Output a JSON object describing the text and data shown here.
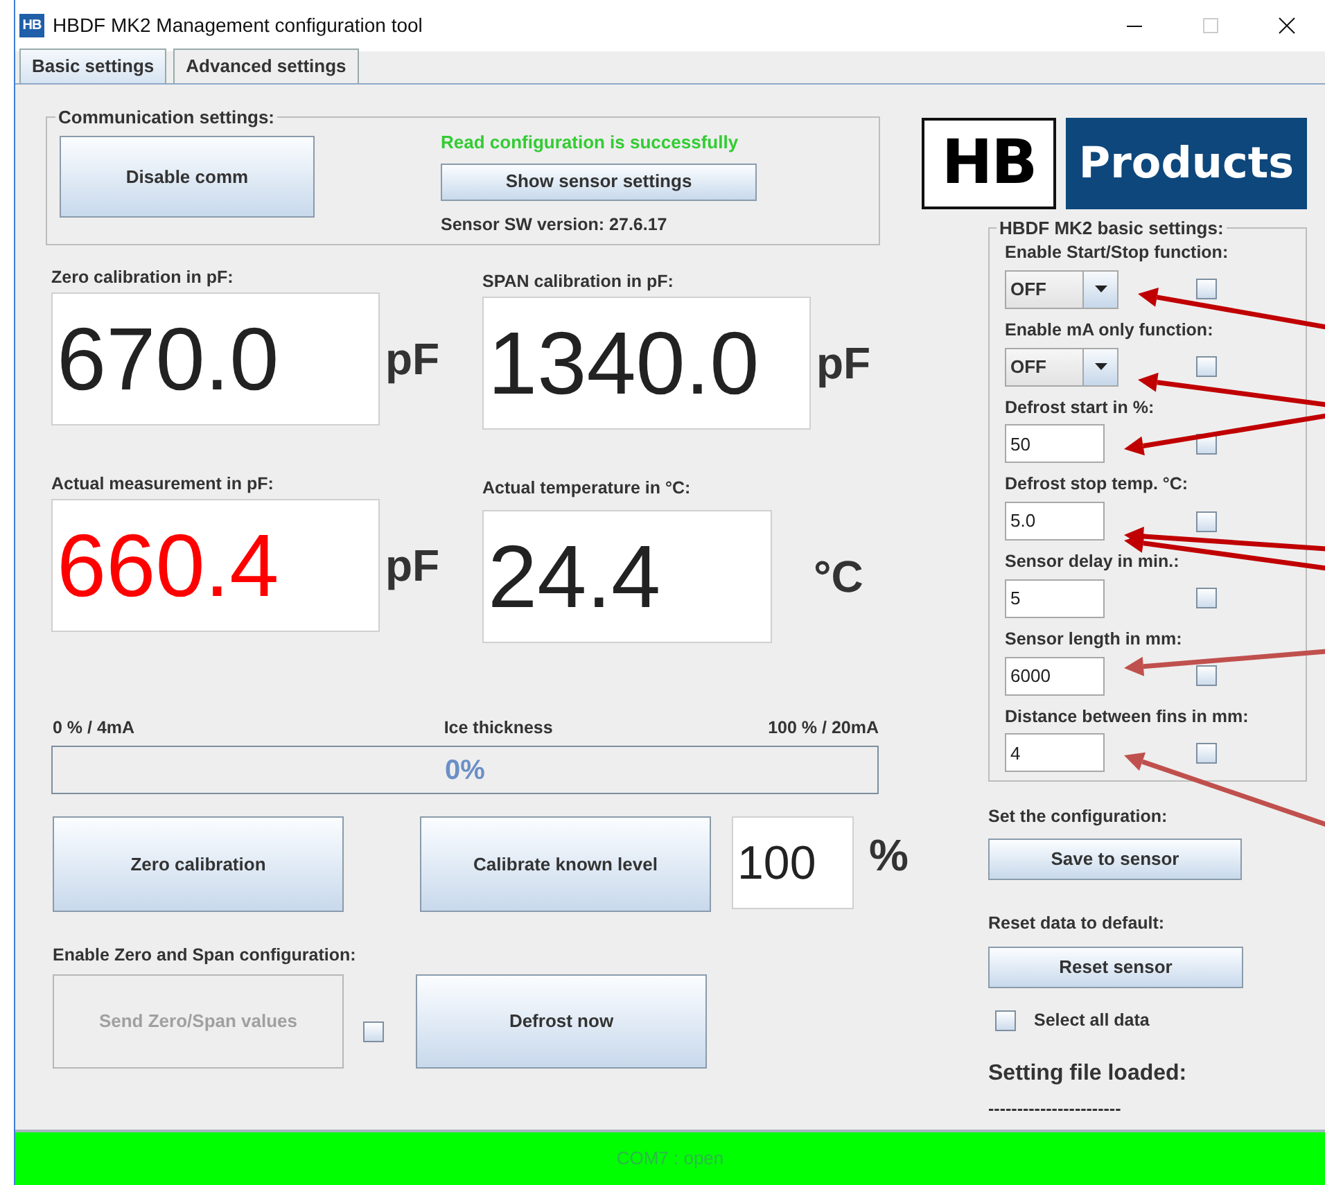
{
  "window": {
    "title": "HBDF MK2 Management configuration tool",
    "icon_text": "HB"
  },
  "tabs": [
    {
      "label": "Basic settings",
      "selected": true
    },
    {
      "label": "Advanced settings",
      "selected": false
    }
  ],
  "communication": {
    "legend": "Communication settings:",
    "disable_button": "Disable comm",
    "status": "Read configuration is successfully",
    "show_button": "Show sensor settings",
    "version": "Sensor SW version: 27.6.17"
  },
  "readouts": [
    {
      "label": "Zero calibration in pF:",
      "value": "670.0",
      "unit": "pF",
      "alarm": false
    },
    {
      "label": "SPAN calibration in pF:",
      "value": "1340.0",
      "unit": "pF",
      "alarm": false
    },
    {
      "label": "Actual measurement in pF:",
      "value": "660.4",
      "unit": "pF",
      "alarm": true
    },
    {
      "label": "Actual temperature in °C:",
      "value": "24.4",
      "unit": "°C",
      "alarm": false
    }
  ],
  "ice": {
    "left_label": "0 % / 4mA",
    "title": "Ice thickness",
    "right_label": "100 % / 20mA",
    "level": 0,
    "reading": "0%"
  },
  "calibration": {
    "zero_button": "Zero calibration",
    "known_button": "Calibrate known level",
    "known_value": "100",
    "unit": "%"
  },
  "zero_span": {
    "label": "Enable Zero and Span configuration:",
    "send_button": "Send Zero/Span values",
    "send_disabled": true,
    "checked": false,
    "defrost_button": "Defrost now"
  },
  "logo": {
    "left": "HB",
    "right": "Products"
  },
  "basic_settings": {
    "legend": "HBDF MK2 basic settings:",
    "items": [
      {
        "kind": "combo",
        "label": "Enable Start/Stop function:",
        "value": "OFF",
        "checked": false
      },
      {
        "kind": "combo",
        "label": "Enable mA only function:",
        "value": "OFF",
        "checked": false
      },
      {
        "kind": "text",
        "label": "Defrost start in %:",
        "value": "50",
        "checked": false
      },
      {
        "kind": "text",
        "label": "Defrost stop temp. °C:",
        "value": "5.0",
        "checked": false
      },
      {
        "kind": "text",
        "label": "Sensor delay in min.:",
        "value": "5",
        "checked": false
      },
      {
        "kind": "text",
        "label": "Sensor length in mm:",
        "value": "6000",
        "checked": false
      },
      {
        "kind": "text",
        "label": "Distance between fins in mm:",
        "value": "4",
        "checked": false
      }
    ]
  },
  "save": {
    "label": "Set the configuration:",
    "button": "Save to sensor"
  },
  "reset": {
    "label": "Reset data to default:",
    "button": "Reset sensor",
    "select_all": {
      "label": "Select all data",
      "checked": false
    }
  },
  "setting_file": {
    "title": "Setting file loaded:",
    "value": "-----------------------"
  },
  "status_bar": {
    "text": "COM7 : open"
  }
}
